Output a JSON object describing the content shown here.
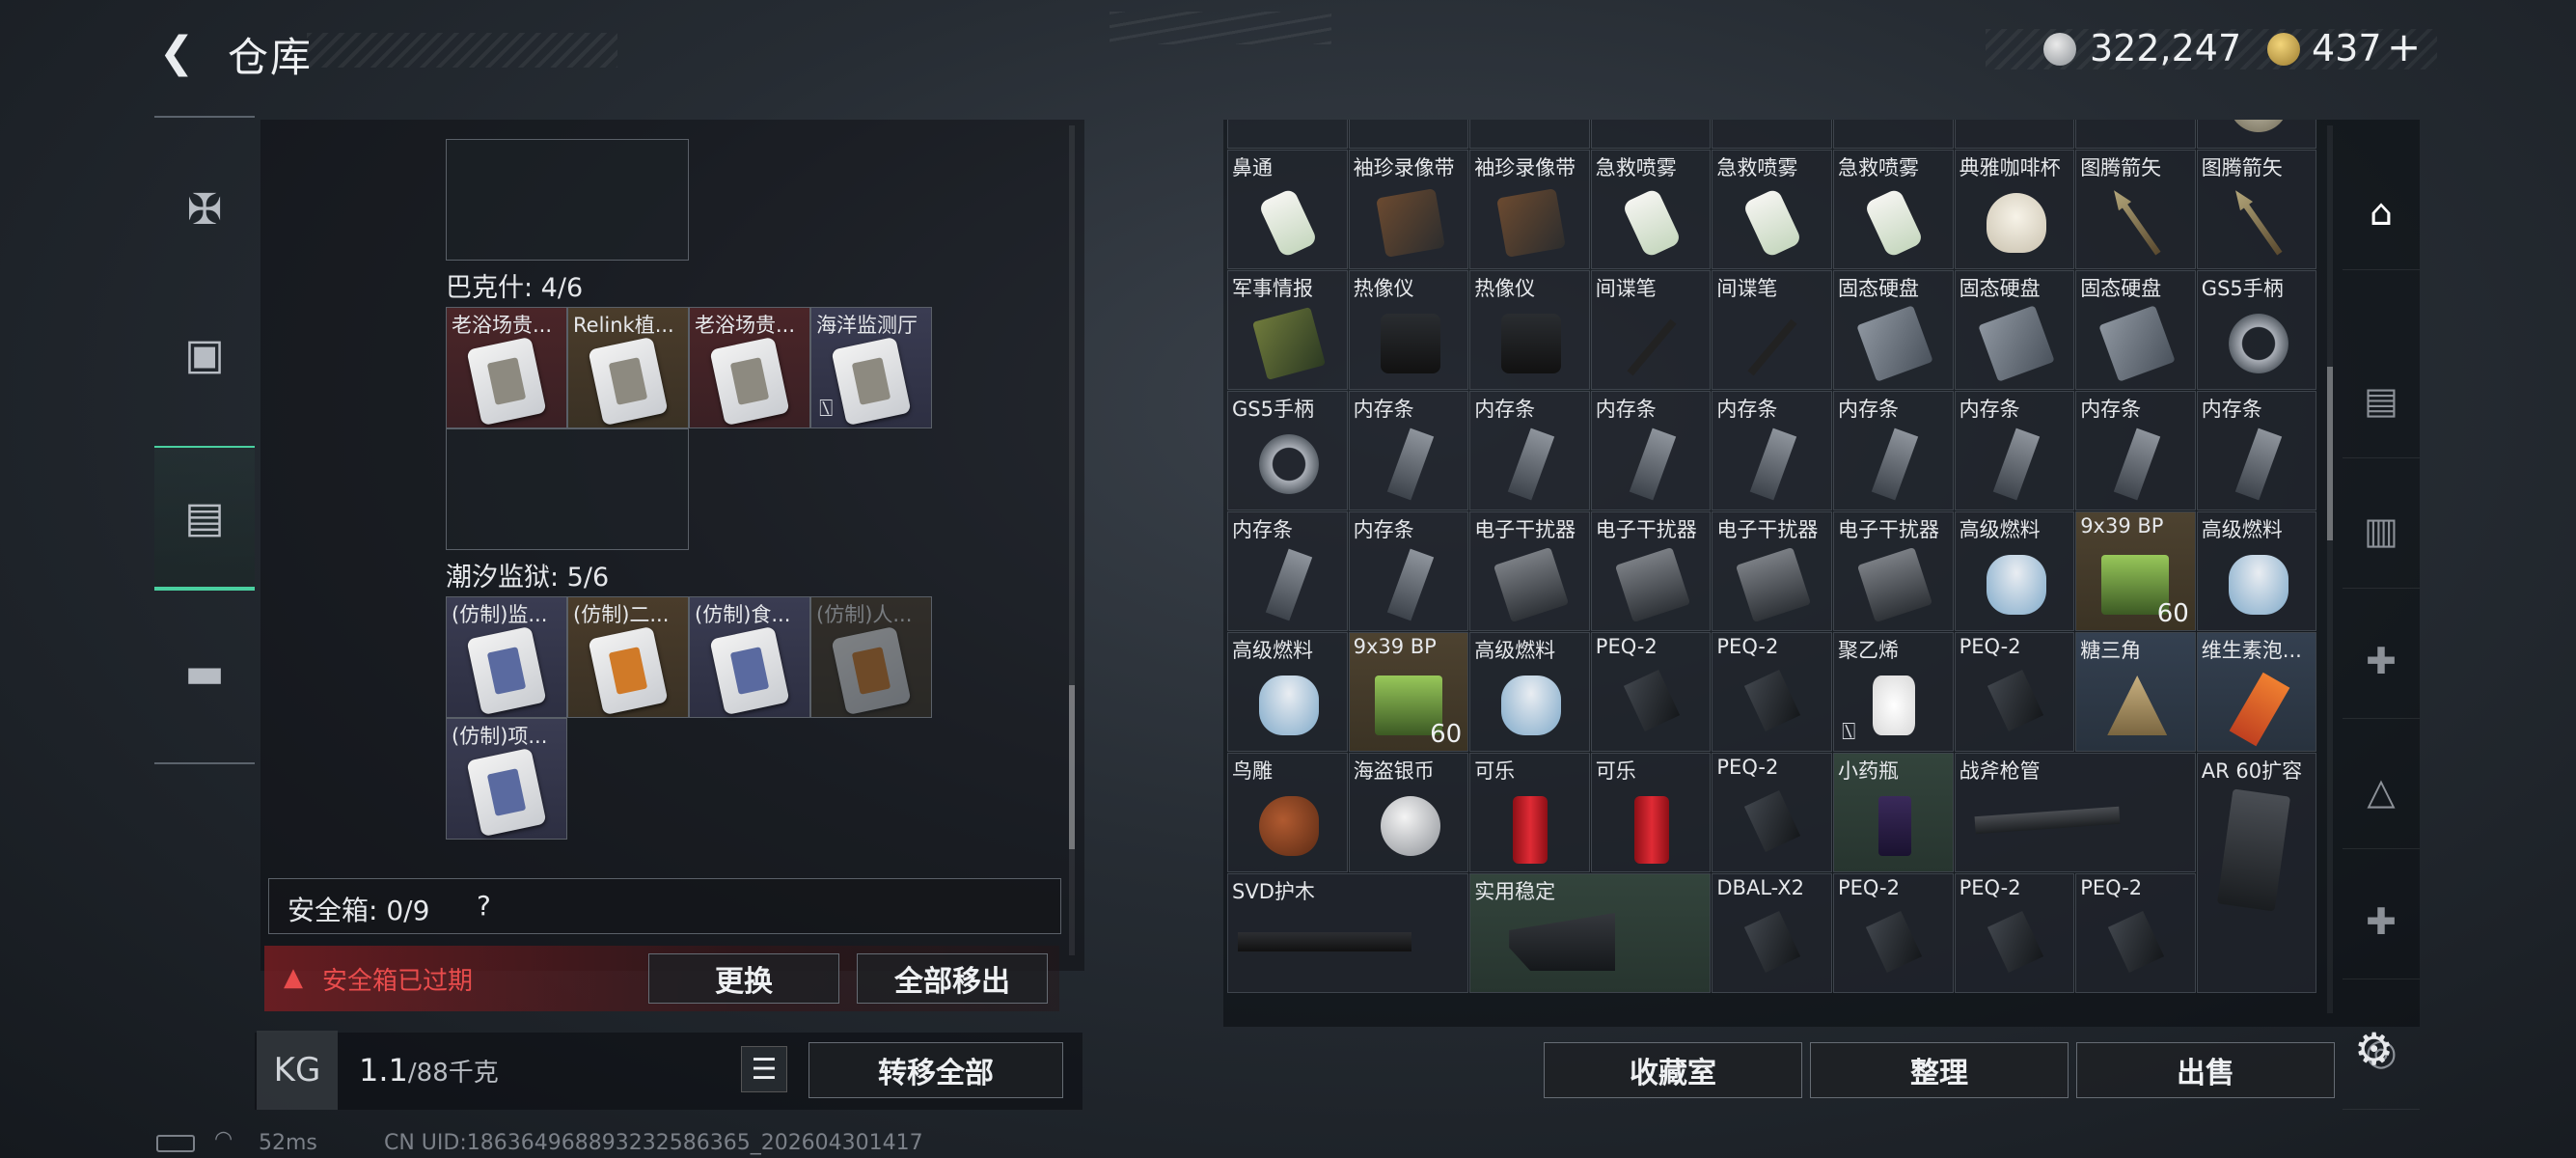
{
  "header": {
    "back_icon": "back-arrow-icon",
    "title": "仓库"
  },
  "currency": {
    "silver": "322,247",
    "gold": "437",
    "plus": "+"
  },
  "left_tabs": [
    {
      "icon": "pistol-icon",
      "label": "weapons"
    },
    {
      "icon": "backpack-icon",
      "label": "backpack"
    },
    {
      "icon": "case-icon",
      "label": "case",
      "active": true
    },
    {
      "icon": "toolbox-icon",
      "label": "toolbox"
    }
  ],
  "groups": [
    {
      "label": "巴克什: 4/6",
      "items": [
        {
          "name": "老浴场贵...",
          "bg": "red"
        },
        {
          "name": "Relink植...",
          "bg": "brn"
        },
        {
          "name": "老浴场贵...",
          "bg": "red"
        },
        {
          "name": "海洋监测厅",
          "bg": "blu",
          "locked": true
        }
      ]
    },
    {
      "label": "潮汐监狱: 5/6",
      "items": [
        {
          "name": "(仿制)监...",
          "bg": "blu"
        },
        {
          "name": "(仿制)二...",
          "bg": "brn"
        },
        {
          "name": "(仿制)食...",
          "bg": "blu"
        },
        {
          "name": "(仿制)人...",
          "bg": "brn"
        },
        {
          "name": "(仿制)项...",
          "bg": "blu"
        }
      ]
    }
  ],
  "safe_box": {
    "label": "安全箱: 0/9",
    "help": "?",
    "warning": "安全箱已过期",
    "warn_icon": "warning-icon",
    "replace_btn": "更换",
    "remove_all_btn": "全部移出"
  },
  "footer_left": {
    "bag_icon": "weight-bag-icon",
    "weight": "1.1",
    "capacity": "/88千克",
    "list_icon": "list-icon",
    "transfer_btn": "转移全部"
  },
  "status": {
    "ping": "52ms",
    "uid": "CN UID:18636496889323258636​5_202604301417"
  },
  "stash_items": [
    {
      "n": "",
      "i": "knife"
    },
    {
      "n": "",
      "i": "knife"
    },
    {
      "n": "",
      "i": "knife"
    },
    {
      "n": "",
      "i": "knife"
    },
    {
      "n": "",
      "i": "knife"
    },
    {
      "n": "",
      "i": "knife"
    },
    {
      "n": "",
      "i": "knife"
    },
    {
      "n": "",
      "i": "knife"
    },
    {
      "n": "",
      "i": "plate"
    },
    {
      "n": "鼻通",
      "i": "spray"
    },
    {
      "n": "袖珍录像带",
      "i": "tape"
    },
    {
      "n": "袖珍录像带",
      "i": "tape"
    },
    {
      "n": "急救喷雾",
      "i": "spray"
    },
    {
      "n": "急救喷雾",
      "i": "spray"
    },
    {
      "n": "急救喷雾",
      "i": "spray"
    },
    {
      "n": "典雅咖啡杯",
      "i": "cup"
    },
    {
      "n": "图腾箭矢",
      "i": "arrow"
    },
    {
      "n": "图腾箭矢",
      "i": "arrow"
    },
    {
      "n": "军事情报",
      "i": "board"
    },
    {
      "n": "热像仪",
      "i": "camera"
    },
    {
      "n": "热像仪",
      "i": "camera"
    },
    {
      "n": "间谍笔",
      "i": "pen"
    },
    {
      "n": "间谍笔",
      "i": "pen"
    },
    {
      "n": "固态硬盘",
      "i": "ssd"
    },
    {
      "n": "固态硬盘",
      "i": "ssd"
    },
    {
      "n": "固态硬盘",
      "i": "ssd"
    },
    {
      "n": "GS5手柄",
      "i": "ring"
    },
    {
      "n": "GS5手柄",
      "i": "ring"
    },
    {
      "n": "内存条",
      "i": "ram"
    },
    {
      "n": "内存条",
      "i": "ram"
    },
    {
      "n": "内存条",
      "i": "ram"
    },
    {
      "n": "内存条",
      "i": "ram"
    },
    {
      "n": "内存条",
      "i": "ram"
    },
    {
      "n": "内存条",
      "i": "ram"
    },
    {
      "n": "内存条",
      "i": "ram"
    },
    {
      "n": "内存条",
      "i": "ram"
    },
    {
      "n": "内存条",
      "i": "ram"
    },
    {
      "n": "内存条",
      "i": "ram"
    },
    {
      "n": "电子干扰器",
      "i": "jam"
    },
    {
      "n": "电子干扰器",
      "i": "jam"
    },
    {
      "n": "电子干扰器",
      "i": "jam"
    },
    {
      "n": "电子干扰器",
      "i": "jam"
    },
    {
      "n": "高级燃料",
      "i": "can"
    },
    {
      "n": "9x39 BP",
      "i": "ammo",
      "c": "60",
      "bg": "brn"
    },
    {
      "n": "高级燃料",
      "i": "can"
    },
    {
      "n": "高级燃料",
      "i": "can"
    },
    {
      "n": "9x39 BP",
      "i": "ammo",
      "c": "60",
      "bg": "brn"
    },
    {
      "n": "高级燃料",
      "i": "can"
    },
    {
      "n": "PEQ-2",
      "i": "peq"
    },
    {
      "n": "PEQ-2",
      "i": "peq"
    },
    {
      "n": "聚乙烯",
      "i": "thread",
      "lock": true
    },
    {
      "n": "PEQ-2",
      "i": "peq"
    },
    {
      "n": "糖三角",
      "i": "tri",
      "bg": "blu"
    },
    {
      "n": "维生素泡...",
      "i": "vit",
      "bg": "blu"
    },
    {
      "n": "鸟雕",
      "i": "bird"
    },
    {
      "n": "海盗银币",
      "i": "coin"
    },
    {
      "n": "可乐",
      "i": "cola"
    },
    {
      "n": "可乐",
      "i": "cola"
    },
    {
      "n": "PEQ-2",
      "i": "peq"
    },
    {
      "n": "小药瓶",
      "i": "bottle",
      "bg": "grn"
    },
    {
      "n": "战斧枪管",
      "i": "rifle",
      "w": 2
    },
    {
      "n": "AR 60扩容",
      "i": "mag",
      "h": 2
    },
    {
      "n": "SVD护木",
      "i": "wood",
      "w": 2
    },
    {
      "n": "实用稳定",
      "i": "stock",
      "w": 2,
      "bg": "grn"
    },
    {
      "n": "DBAL-X2",
      "i": "peq"
    },
    {
      "n": "PEQ-2",
      "i": "peq"
    },
    {
      "n": "PEQ-2",
      "i": "peq"
    },
    {
      "n": "PEQ-2",
      "i": "peq"
    }
  ],
  "right_tabs": [
    {
      "icon": "home-stash-icon",
      "active": true
    },
    {
      "icon": "stash-folder-4-icon"
    },
    {
      "icon": "stash-truck-4-icon"
    },
    {
      "icon": "stash-medkit-4-icon"
    },
    {
      "icon": "stash-ammo-4-icon"
    },
    {
      "icon": "stash-addmed-4-icon"
    },
    {
      "icon": "stash-camera-5-icon"
    }
  ],
  "footer_right": {
    "collection_btn": "收藏室",
    "sort_btn": "整理",
    "sell_btn": "出售",
    "settings_icon": "gear-icon"
  }
}
